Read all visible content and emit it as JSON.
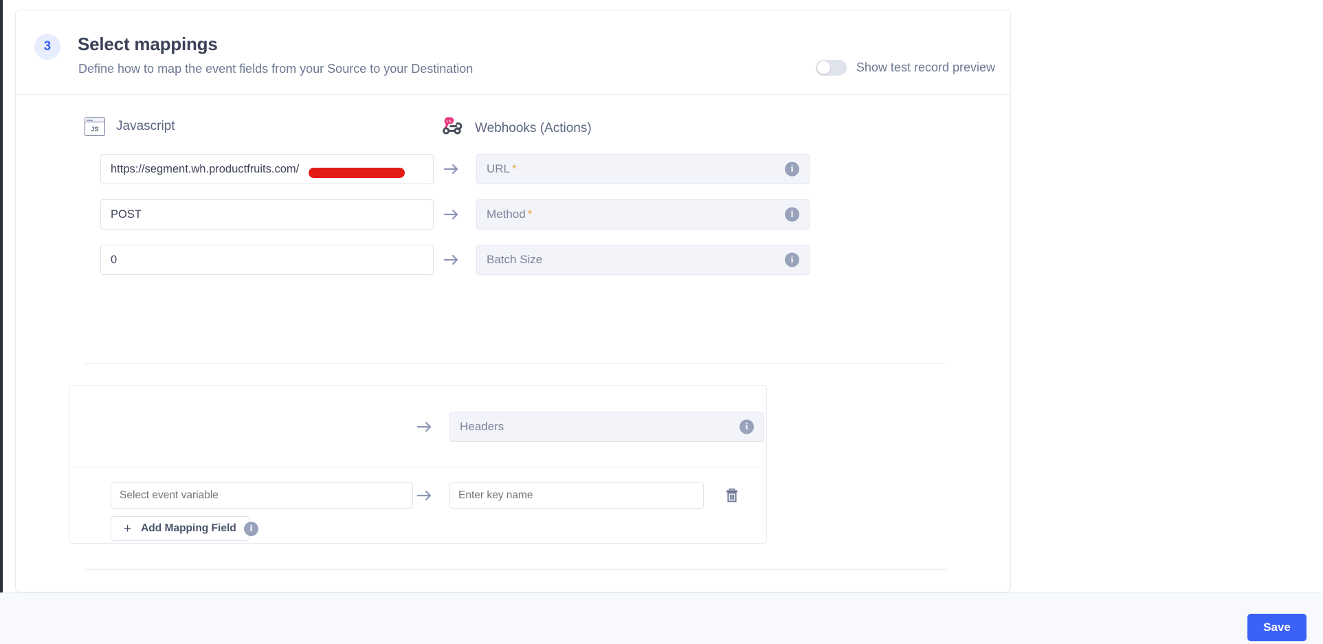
{
  "header": {
    "step_number": "3",
    "title": "Select mappings",
    "subtitle": "Define how to map the event fields from your Source to your Destination",
    "preview_toggle_label": "Show test record preview",
    "preview_toggle_state": "off"
  },
  "columns": {
    "source": {
      "label": "Javascript",
      "icon": "javascript-icon",
      "icon_text": "JS"
    },
    "destination": {
      "label": "Webhooks (Actions)",
      "icon": "webhooks-icon"
    }
  },
  "mappings": [
    {
      "source_value": "https://segment.wh.productfruits.com/",
      "redacted": true,
      "dest_label": "URL",
      "dest_required": "*"
    },
    {
      "source_value": "POST",
      "redacted": false,
      "dest_label": "Method",
      "dest_required": "*"
    },
    {
      "source_value": "0",
      "redacted": false,
      "dest_label": "Batch Size",
      "dest_required": ""
    }
  ],
  "headers_section": {
    "dest_label": "Headers",
    "key_value_row": {
      "source_placeholder": "Select event variable",
      "dest_placeholder": "Enter key name",
      "delete_icon": "trash-icon"
    },
    "add_button_label": "Add Mapping Field",
    "add_button_plus": "+"
  },
  "footer": {
    "save_label": "Save"
  },
  "colors": {
    "accent_blue": "#3b62f6",
    "redaction_red": "#e31b17",
    "disabled_field_bg": "#f2f4f9",
    "required_asterisk": "#e8a33d",
    "webhook_pink": "#e8357c"
  },
  "info_glyph": "i"
}
